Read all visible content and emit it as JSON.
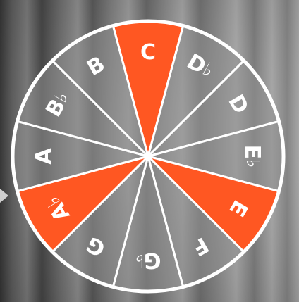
{
  "wheel": {
    "segments": [
      {
        "note": "C",
        "base": "C",
        "accidental": "",
        "highlighted": true
      },
      {
        "note": "D♭",
        "base": "D",
        "accidental": "♭",
        "highlighted": false
      },
      {
        "note": "D",
        "base": "D",
        "accidental": "",
        "highlighted": false
      },
      {
        "note": "E♭",
        "base": "E",
        "accidental": "♭",
        "highlighted": false
      },
      {
        "note": "E",
        "base": "E",
        "accidental": "",
        "highlighted": true
      },
      {
        "note": "F",
        "base": "F",
        "accidental": "",
        "highlighted": false
      },
      {
        "note": "G♭",
        "base": "G",
        "accidental": "♭",
        "highlighted": false
      },
      {
        "note": "G",
        "base": "G",
        "accidental": "",
        "highlighted": false
      },
      {
        "note": "A♭",
        "base": "A",
        "accidental": "♭",
        "highlighted": true
      },
      {
        "note": "A",
        "base": "A",
        "accidental": "",
        "highlighted": false
      },
      {
        "note": "B♭",
        "base": "B",
        "accidental": "♭",
        "highlighted": false
      },
      {
        "note": "B",
        "base": "B",
        "accidental": "",
        "highlighted": false
      }
    ]
  },
  "colors": {
    "highlight": "#ff5722",
    "segment": "#8e8e8e",
    "border": "#ffffff"
  },
  "icons": {
    "pointer": "triangle-right-icon"
  }
}
